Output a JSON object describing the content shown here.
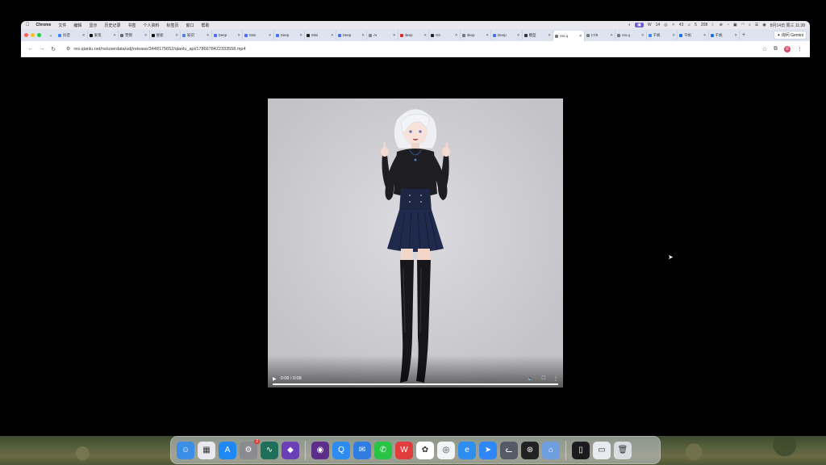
{
  "menubar": {
    "apple": "",
    "app": "Chrome",
    "items": [
      "文件",
      "编辑",
      "显示",
      "历史记录",
      "书签",
      "个人资料",
      "标签页",
      "窗口",
      "帮助"
    ],
    "tray": [
      "14",
      "43",
      "5",
      "208"
    ],
    "datetime": "8月14日 周三 11:38"
  },
  "tabs": [
    {
      "title": "抖音",
      "color": "#4285f4"
    },
    {
      "title": "发现",
      "color": "#111111"
    },
    {
      "title": "营销",
      "color": "#666666"
    },
    {
      "title": "搜索",
      "color": "#111111"
    },
    {
      "title": "知识",
      "color": "#5a7fd8"
    },
    {
      "title": "Deep",
      "color": "#4d6bfe"
    },
    {
      "title": "Mini",
      "color": "#4d6bfe"
    },
    {
      "title": "Deep",
      "color": "#4d6bfe"
    },
    {
      "title": "Mini",
      "color": "#222222"
    },
    {
      "title": "Deep",
      "color": "#4d6bfe"
    },
    {
      "title": "AI",
      "color": "#888888"
    },
    {
      "title": "deep",
      "color": "#e02a2a"
    },
    {
      "title": "Git",
      "color": "#222222"
    },
    {
      "title": "deep",
      "color": "#777777"
    },
    {
      "title": "Deep",
      "color": "#4d6bfe"
    },
    {
      "title": "模型",
      "color": "#333333"
    },
    {
      "title": "res.q",
      "color": "#777777",
      "active": true
    },
    {
      "title": "17/8",
      "color": "#777777"
    },
    {
      "title": "res.q",
      "color": "#777777"
    },
    {
      "title": "千帆",
      "color": "#4285f4"
    },
    {
      "title": "千帆",
      "color": "#1f6fe5"
    },
    {
      "title": "千帆",
      "color": "#1f6fe5"
    }
  ],
  "tabstrip": {
    "new_tab": "+",
    "gemini": "✦ 询问 Gemini"
  },
  "toolbar": {
    "back": "←",
    "forward": "→",
    "reload": "↻",
    "site_info": "⚙",
    "url": "res.qianlu.net/ns/userdata/udj/release/3448175652/qianlu_api/1786678422333558.mp4",
    "bookmark": "☆",
    "extensions": "⧉",
    "profile": "R",
    "menu": "⋮"
  },
  "video": {
    "current_time": "0:08",
    "separator": "/",
    "duration": "0:08",
    "progress": 1.0,
    "play": "▶",
    "volume": "🔈",
    "fullscreen": "⛶",
    "more": "⋮"
  },
  "dock": {
    "apps": [
      {
        "name": "finder",
        "color": "#3a8ee6",
        "glyph": "☺"
      },
      {
        "name": "launchpad",
        "color": "#e8e8ee",
        "glyph": "▦"
      },
      {
        "name": "app-store",
        "color": "#1e88f5",
        "glyph": "A"
      },
      {
        "name": "system-settings",
        "color": "#8a8a90",
        "glyph": "⚙",
        "badge": "2"
      },
      {
        "name": "activity",
        "color": "#1d6f5a",
        "glyph": "∿"
      },
      {
        "name": "obsidian",
        "color": "#6b3fb6",
        "glyph": "◆"
      },
      {
        "name": "sep"
      },
      {
        "name": "tor-browser",
        "color": "#5b2e8c",
        "glyph": "◉"
      },
      {
        "name": "quark",
        "color": "#2e8bf0",
        "glyph": "Q"
      },
      {
        "name": "mail",
        "color": "#2f7de0",
        "glyph": "✉"
      },
      {
        "name": "wechat",
        "color": "#28c445",
        "glyph": "✆"
      },
      {
        "name": "wps",
        "color": "#e23d3d",
        "glyph": "W"
      },
      {
        "name": "chatgpt",
        "color": "#ffffff",
        "glyph": "✿"
      },
      {
        "name": "chrome",
        "color": "#f1f3f4",
        "glyph": "◎"
      },
      {
        "name": "edge-browser",
        "color": "#2e8ef0",
        "glyph": "e"
      },
      {
        "name": "send",
        "color": "#2f86f6",
        "glyph": "➤"
      },
      {
        "name": "cat-app",
        "color": "#555a66",
        "glyph": "ᓚ"
      },
      {
        "name": "chatgpt-alt",
        "color": "#222222",
        "glyph": "⊛"
      },
      {
        "name": "simulator",
        "color": "#6d9fe0",
        "glyph": "⌂"
      },
      {
        "name": "sep"
      },
      {
        "name": "iphone-mirroring",
        "color": "#1c1c1e",
        "glyph": "▯"
      },
      {
        "name": "finder-window",
        "color": "#e8eaef",
        "glyph": "▭"
      },
      {
        "name": "trash",
        "color": "#d9dde2",
        "glyph": "🗑"
      }
    ]
  }
}
